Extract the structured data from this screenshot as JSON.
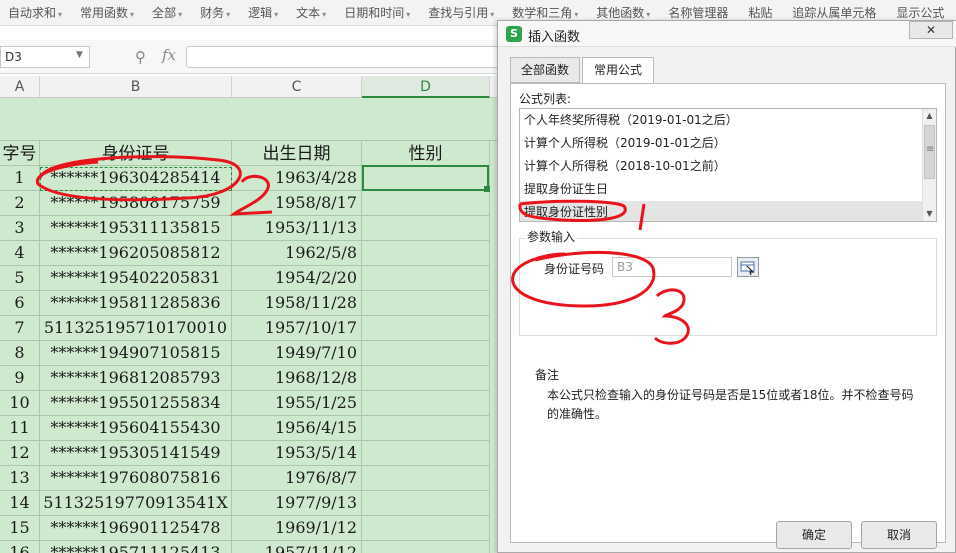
{
  "ribbon": [
    "自动求和",
    "常用函数",
    "全部",
    "财务",
    "逻辑",
    "文本",
    "日期和时间",
    "查找与引用",
    "数学和三角",
    "其他函数",
    "名称管理器",
    "粘贴",
    "追踪从属单元格",
    "显示公式"
  ],
  "formula_bar": {
    "name_box": "D3",
    "fx_label": "fx"
  },
  "columns": [
    "A",
    "B",
    "C",
    "D"
  ],
  "headers": {
    "a": "字号",
    "b": "身份证号",
    "c": "出生日期",
    "d": "性别"
  },
  "rows": [
    {
      "a": "1",
      "b": "******196304285414",
      "c": "1963/4/28"
    },
    {
      "a": "2",
      "b": "******195808175759",
      "c": "1958/8/17"
    },
    {
      "a": "3",
      "b": "******195311135815",
      "c": "1953/11/13"
    },
    {
      "a": "4",
      "b": "******196205085812",
      "c": "1962/5/8"
    },
    {
      "a": "5",
      "b": "******195402205831",
      "c": "1954/2/20"
    },
    {
      "a": "6",
      "b": "******195811285836",
      "c": "1958/11/28"
    },
    {
      "a": "7",
      "b": "511325195710170010",
      "c": "1957/10/17"
    },
    {
      "a": "8",
      "b": "******194907105815",
      "c": "1949/7/10"
    },
    {
      "a": "9",
      "b": "******196812085793",
      "c": "1968/12/8"
    },
    {
      "a": "10",
      "b": "******195501255834",
      "c": "1955/1/25"
    },
    {
      "a": "11",
      "b": "******195604155430",
      "c": "1956/4/15"
    },
    {
      "a": "12",
      "b": "******195305141549",
      "c": "1953/5/14"
    },
    {
      "a": "13",
      "b": "******197608075816",
      "c": "1976/8/7"
    },
    {
      "a": "14",
      "b": "51132519770913541X",
      "c": "1977/9/13"
    },
    {
      "a": "15",
      "b": "******196901125478",
      "c": "1969/1/12"
    },
    {
      "a": "16",
      "b": "******195711125413",
      "c": "1957/11/12"
    }
  ],
  "dialog": {
    "title": "插入函数",
    "logo": "S",
    "close": "✕",
    "tabs": [
      "全部函数",
      "常用公式"
    ],
    "list_label": "公式列表:",
    "formulas": [
      "个人年终奖所得税（2019-01-01之后）",
      "计算个人所得税（2019-01-01之后）",
      "计算个人所得税（2018-10-01之前）",
      "提取身份证生日",
      "提取身份证性别"
    ],
    "param_label": "参数输入",
    "param_field": "身份证号码",
    "param_value": "B3",
    "notes_label": "备注",
    "notes_text": "本公式只检查输入的身份证号码是否是15位或者18位。并不检查号码的准确性。",
    "ok": "确定",
    "cancel": "取消"
  },
  "annotations": [
    "1",
    "2",
    "3"
  ],
  "colors": {
    "sheet_bg": "#cfe9cf",
    "selection": "#2b8a3e",
    "annotation": "#e8141c"
  }
}
